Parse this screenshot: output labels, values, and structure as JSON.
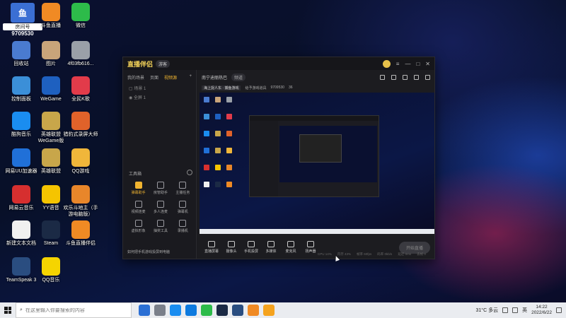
{
  "overlay_badge": {
    "tag": "房间号",
    "number": "9709530"
  },
  "desktop_icons": [
    {
      "label": "回收站",
      "icon": "recycle-bin-icon",
      "color": "#4a7bd0"
    },
    {
      "label": "图片",
      "icon": "image-file-icon",
      "color": "#c9a47a"
    },
    {
      "label": "4f03fb616...",
      "icon": "image-file-icon",
      "color": "#9aa0a8"
    },
    {
      "label": "控制面板",
      "icon": "control-panel-icon",
      "color": "#3b8fd8"
    },
    {
      "label": "WeGame",
      "icon": "wegame-icon",
      "color": "#1e60c0"
    },
    {
      "label": "全民K歌",
      "icon": "kge-icon",
      "color": "#e23b4a"
    },
    {
      "label": "酷狗音乐",
      "icon": "kugou-icon",
      "color": "#1a8df0"
    },
    {
      "label": "英雄联盟 WeGame版",
      "icon": "lol-icon",
      "color": "#c8a64a"
    },
    {
      "label": "猎豹式录屏大师",
      "icon": "recorder-icon",
      "color": "#e0622a"
    },
    {
      "label": "网易UU加速器",
      "icon": "uu-icon",
      "color": "#2070d8"
    },
    {
      "label": "英雄联盟",
      "icon": "lol-icon",
      "color": "#c8a64a"
    },
    {
      "label": "QQ游戏",
      "icon": "qq-game-icon",
      "color": "#f0b63a"
    },
    {
      "label": "网易云音乐",
      "icon": "netease-music-icon",
      "color": "#d62f2f"
    },
    {
      "label": "YY语音",
      "icon": "yy-icon",
      "color": "#f5c400"
    },
    {
      "label": "欢乐斗地主（手游电脑版）",
      "icon": "doudizhu-icon",
      "color": "#e8862a"
    },
    {
      "label": "新建文本文档",
      "icon": "text-file-icon",
      "color": "#f0f0f0"
    },
    {
      "label": "Steam",
      "icon": "steam-icon",
      "color": "#1b2a45"
    },
    {
      "label": "斗鱼直播伴侣",
      "icon": "douyu-icon",
      "color": "#f08a24"
    },
    {
      "label": "TeamSpeak 3",
      "icon": "teamspeak-icon",
      "color": "#2a4d80"
    },
    {
      "label": "QQ音乐",
      "icon": "qq-music-icon",
      "color": "#f5d400"
    },
    {
      "label": "斗鱼直播",
      "icon": "douyu-icon",
      "color": "#f08a24"
    },
    {
      "label": "微信",
      "icon": "wechat-icon",
      "color": "#2dbb4a"
    }
  ],
  "app": {
    "title": "直播伴侣",
    "version": "游客",
    "left_tabs": [
      "我的场景",
      "页面",
      "视频源"
    ],
    "scene_items": [
      "场景 1",
      "全屏 1"
    ],
    "toolbox_title": "工具箱",
    "tools": [
      {
        "label": "弹幕助手",
        "hot": true
      },
      {
        "label": "房管助手",
        "hot": false
      },
      {
        "label": "主播任务",
        "hot": false
      },
      {
        "label": "视频连麦",
        "hot": false
      },
      {
        "label": "多人连麦",
        "hot": false
      },
      {
        "label": "弹幕机",
        "hot": false
      },
      {
        "label": "虚拟形象",
        "hot": false
      },
      {
        "label": "抽奖工具",
        "hot": false
      },
      {
        "label": "录播机",
        "hot": false
      }
    ],
    "left_footer": "如何把手机游戏投屏到电脑",
    "room_title": "南宁迪丽热巴",
    "room_sub": "频道",
    "room_tag": "海上捉人东 · 捕鱼游戏",
    "room_line2": "给予游戏道具",
    "room_number": "9709530",
    "room_count": "36",
    "controls": [
      "直播屏幕",
      "摄像头",
      "手机投屏",
      "多媒体",
      "麦克风",
      "扬声器"
    ],
    "start_button": "开始直播",
    "status_items": [
      "CPU 14%",
      "内存 43%",
      "帧率 60fps",
      "码率 0kb/s",
      "延迟 0ms",
      "丢帧 0"
    ]
  },
  "taskbar": {
    "search_placeholder": "在这里输入你要搜索的内容",
    "weather": "31°C 多云",
    "ime": "英",
    "time": "14:22",
    "date": "2022/6/22"
  }
}
